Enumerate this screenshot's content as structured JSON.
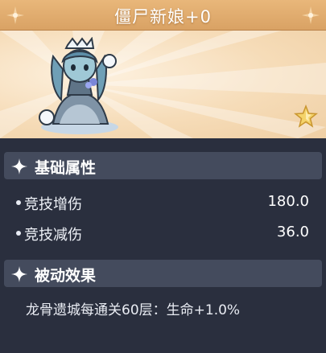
{
  "header": {
    "title": "僵尸新娘+0"
  },
  "icons": {
    "title_ornament": "ornament-icon",
    "section": "sparkle-icon",
    "badge": "star-icon",
    "bullet": "bullet-dot"
  },
  "colors": {
    "title_bar": "#e0ab6d",
    "banner": "#f6dcb8",
    "panel": "#2a2f3e",
    "section_header": "#444b5d",
    "star": "#f4d36a"
  },
  "sections": {
    "basic": {
      "title": "基础属性",
      "stats": [
        {
          "name": "竞技增伤",
          "value": "180.0"
        },
        {
          "name": "竞技减伤",
          "value": "36.0"
        }
      ]
    },
    "passive": {
      "title": "被动效果",
      "text": "龙骨遗城每通关60层：生命+1.0%"
    }
  }
}
